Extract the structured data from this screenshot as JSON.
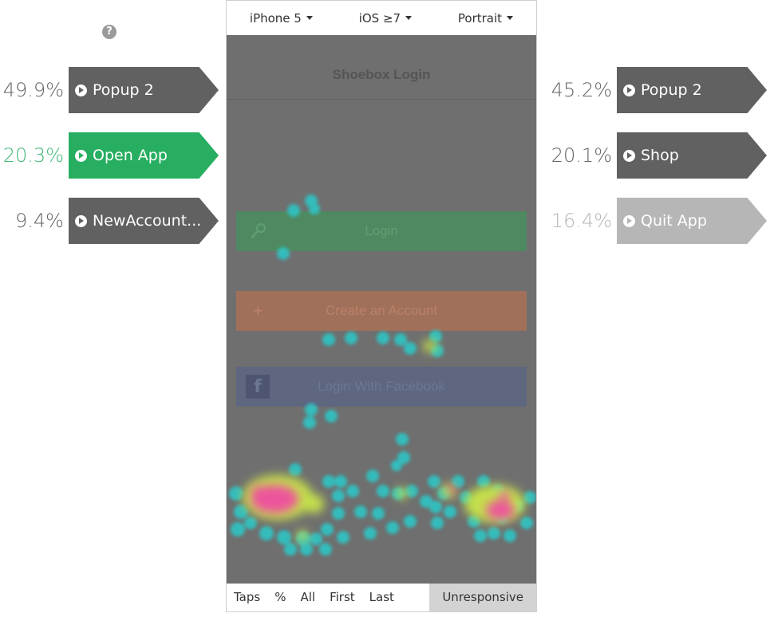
{
  "help_icon": "?",
  "left_flows": [
    {
      "percent": "49.9%",
      "label": "Popup 2",
      "style": "dark"
    },
    {
      "percent": "20.3%",
      "label": "Open App",
      "style": "green"
    },
    {
      "percent": "9.4%",
      "label": "NewAccount...",
      "style": "dark"
    }
  ],
  "right_flows": [
    {
      "percent": "45.2%",
      "label": "Popup 2",
      "style": "dark"
    },
    {
      "percent": "20.1%",
      "label": "Shop",
      "style": "dark"
    },
    {
      "percent": "16.4%",
      "label": "Quit App",
      "style": "light"
    }
  ],
  "phone": {
    "device": "iPhone 5",
    "os": "iOS ≥7",
    "orientation": "Portrait",
    "screen_title": "Shoebox Login",
    "buttons": {
      "login": "Login",
      "create": "Create an Account",
      "facebook": "Login With Facebook"
    },
    "facebook_glyph": "f",
    "bottom_tabs": {
      "taps": "Taps",
      "percent": "%",
      "all": "All",
      "first": "First",
      "last": "Last",
      "unresponsive": "Unresponsive"
    }
  },
  "colors": {
    "green_accent": "#27ae60",
    "dark_arrow": "#616161",
    "light_arrow": "#b6b6b6",
    "heat_low": "#2ec4c4",
    "heat_mid": "#c8e64a",
    "heat_high": "#f04ea0"
  }
}
